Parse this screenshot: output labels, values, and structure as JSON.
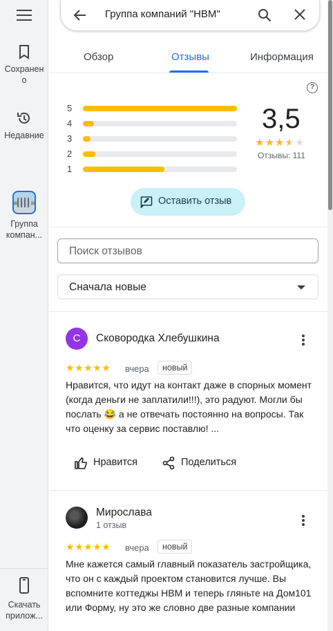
{
  "rail": {
    "saved_label": "Сохранено",
    "recent_label": "Недавние",
    "place_label": "Группа компан...",
    "download_label": "Скачать прилож..."
  },
  "search": {
    "query": "Группа компаний \"НВМ\""
  },
  "tabs": [
    {
      "label": "Обзор"
    },
    {
      "label": "Отзывы"
    },
    {
      "label": "Информация"
    }
  ],
  "rating": {
    "value": "3,5",
    "stars": 3.5,
    "count_text": "Отзывы: 111",
    "distribution": [
      {
        "stars": "5",
        "fraction": 1.0
      },
      {
        "stars": "4",
        "fraction": 0.07
      },
      {
        "stars": "3",
        "fraction": 0.05
      },
      {
        "stars": "2",
        "fraction": 0.08
      },
      {
        "stars": "1",
        "fraction": 0.53
      }
    ]
  },
  "write_review_label": "Оставить отзыв",
  "reviews_search": {
    "placeholder": "Поиск отзывов"
  },
  "sort": {
    "value": "Сначала новые"
  },
  "reviews": [
    {
      "initial": "С",
      "avatar_color": "#9334e6",
      "name": "Сковородка Хлебушкина",
      "subtitle": "",
      "when": "вчера",
      "badge": "новый",
      "rating": 5,
      "text": "Нравится, что идут на контакт даже в спорных момент (когда деньги не заплатили!!!), это радуют. Могли бы послать 😂 а не отвечать постоянно на вопросы. Так что оценку за сервис поставлю! ...",
      "like_label": "Нравится",
      "share_label": "Поделиться"
    },
    {
      "initial": "",
      "avatar_color": "#1f1f1f",
      "name": "Мирослава",
      "subtitle": "1 отзыв",
      "when": "вчера",
      "badge": "новый",
      "rating": 5,
      "text": "Мне кажется самый главный показатель застройщика, что он с каждый проектом становится лучше. Вы вспомните коттеджы НВМ и теперь гляньте на Дом101 или Форму, ну это же словно две разные компании"
    }
  ],
  "icons": {
    "menu": "menu-icon",
    "saved": "bookmark-icon",
    "recent": "history-icon",
    "back": "arrow-back-icon",
    "search": "search-icon",
    "close": "close-icon",
    "help": "help-icon",
    "write": "rate-review-icon",
    "like": "thumb-up-icon",
    "share": "share-icon",
    "more": "more-vert-icon",
    "download": "phone-icon"
  },
  "colors": {
    "accent": "#1a73e8",
    "star": "#fbbc04",
    "write_button_bg": "#c9f1f7"
  }
}
